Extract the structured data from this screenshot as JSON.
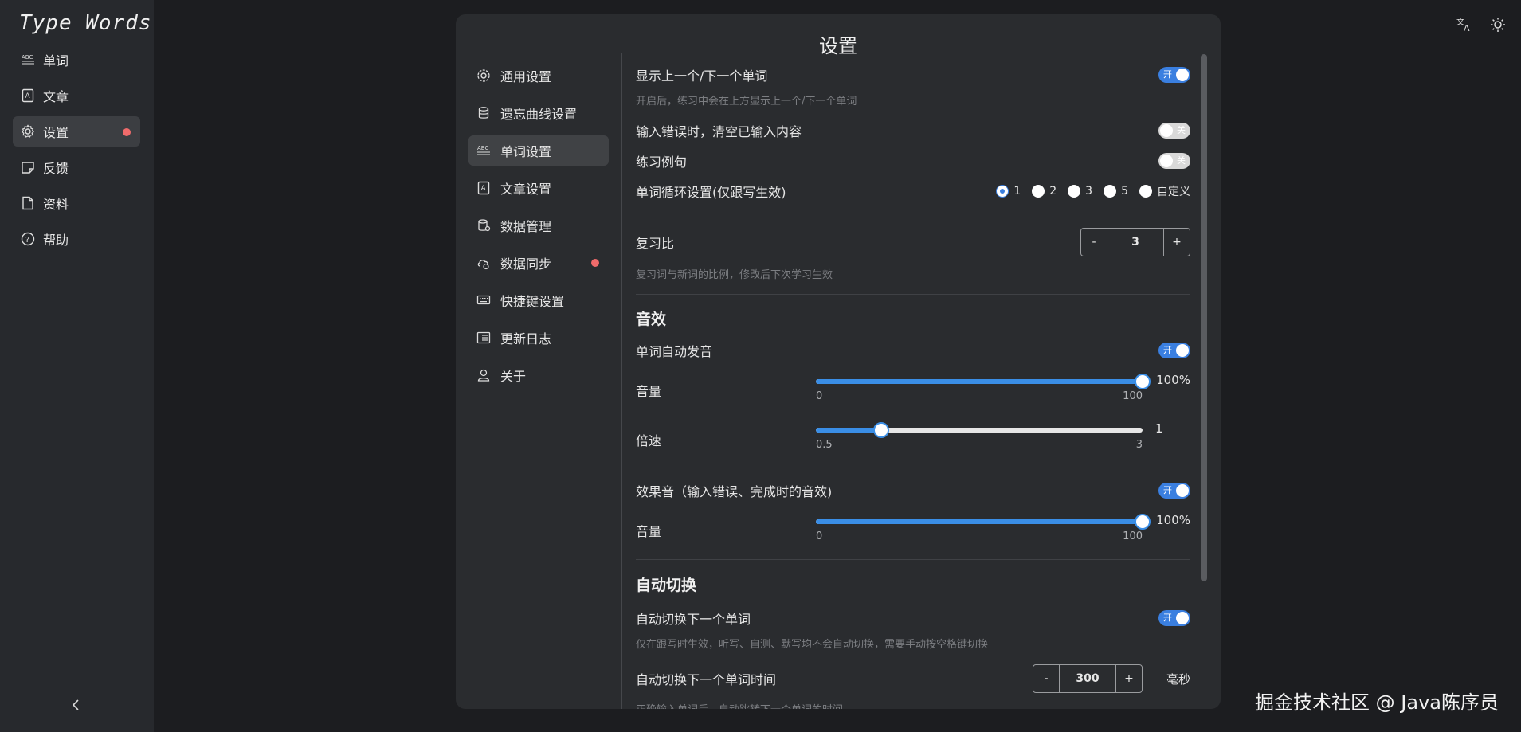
{
  "app": {
    "logo": "Type Words"
  },
  "sidebar": {
    "items": [
      {
        "label": "单词",
        "icon": "abc-icon"
      },
      {
        "label": "文章",
        "icon": "article-icon"
      },
      {
        "label": "设置",
        "icon": "gear-icon",
        "active": true,
        "badge": true
      },
      {
        "label": "反馈",
        "icon": "note-icon"
      },
      {
        "label": "资料",
        "icon": "file-icon"
      },
      {
        "label": "帮助",
        "icon": "help-icon"
      }
    ]
  },
  "topbar": {
    "icons": [
      "translate-icon",
      "theme-sun-icon"
    ]
  },
  "modal": {
    "title": "设置",
    "menu": [
      {
        "label": "通用设置",
        "icon": "gear-icon"
      },
      {
        "label": "遗忘曲线设置",
        "icon": "database-icon"
      },
      {
        "label": "单词设置",
        "icon": "abc-icon",
        "active": true
      },
      {
        "label": "文章设置",
        "icon": "article-icon"
      },
      {
        "label": "数据管理",
        "icon": "data-icon"
      },
      {
        "label": "数据同步",
        "icon": "cloud-sync-icon",
        "badge": true
      },
      {
        "label": "快捷键设置",
        "icon": "keyboard-icon"
      },
      {
        "label": "更新日志",
        "icon": "list-icon"
      },
      {
        "label": "关于",
        "icon": "user-icon"
      }
    ]
  },
  "settings": {
    "show_prev_next": {
      "label": "显示上一个/下一个单词",
      "state": "开",
      "hint": "开启后，练习中会在上方显示上一个/下一个单词"
    },
    "clear_on_error": {
      "label": "输入错误时，清空已输入内容",
      "state": "关"
    },
    "practice_examples": {
      "label": "练习例句",
      "state": "关"
    },
    "loop": {
      "label": "单词循环设置(仅跟写生效)",
      "options": [
        "1",
        "2",
        "3",
        "5",
        "自定义"
      ],
      "selected": "1"
    },
    "review_ratio": {
      "label": "复习比",
      "minus": "-",
      "plus": "+",
      "value": "3",
      "hint": "复习词与新词的比例，修改后下次学习生效"
    },
    "sound_section": "音效",
    "auto_pronounce": {
      "label": "单词自动发音",
      "state": "开"
    },
    "volume": {
      "label": "音量",
      "value_text": "100%",
      "min": "0",
      "max": "100",
      "fraction": 1.0
    },
    "speed": {
      "label": "倍速",
      "value_text": "1",
      "min": "0.5",
      "max": "3",
      "fraction": 0.2
    },
    "effect_sound": {
      "label": "效果音（输入错误、完成时的音效)",
      "state": "开"
    },
    "effect_volume": {
      "label": "音量",
      "value_text": "100%",
      "min": "0",
      "max": "100",
      "fraction": 1.0
    },
    "auto_switch_section": "自动切换",
    "auto_next": {
      "label": "自动切换下一个单词",
      "state": "开",
      "hint": "仅在跟写时生效，听写、自测、默写均不会自动切换，需要手动按空格键切换"
    },
    "auto_next_time": {
      "label": "自动切换下一个单词时间",
      "minus": "-",
      "plus": "+",
      "value": "300",
      "unit": "毫秒",
      "hint": "正确输入单词后，自动跳转下一个单词的时间"
    }
  },
  "watermark": "掘金技术社区 @ Java陈序员"
}
